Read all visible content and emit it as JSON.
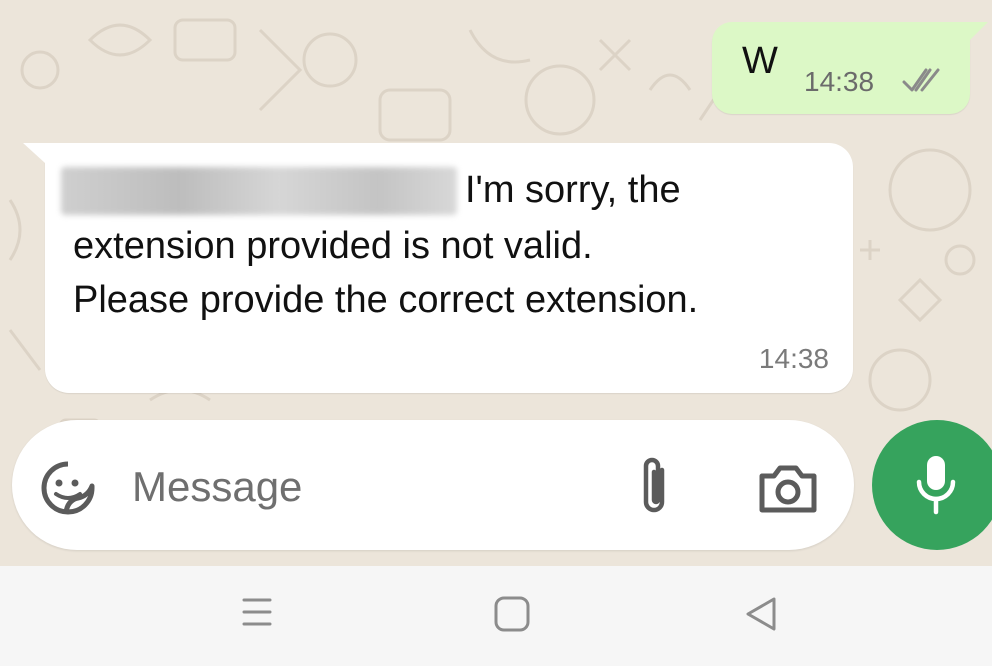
{
  "conversation": {
    "outgoing": {
      "text": "W",
      "time": "14:38",
      "status_icon": "double-check-icon"
    },
    "incoming": {
      "line1": "I'm sorry, the",
      "line2": "extension provided is not valid.",
      "line3": "Please provide the correct extension.",
      "time": "14:38"
    }
  },
  "composer": {
    "placeholder": "Message",
    "icons": [
      "sticker-icon",
      "paperclip-icon",
      "camera-icon",
      "mic-icon"
    ]
  },
  "navbar": {
    "icons": [
      "menu-icon",
      "home-icon",
      "back-icon"
    ]
  },
  "colors": {
    "chat_background": "#ece5da",
    "outgoing_bubble": "#dcf8c6",
    "incoming_bubble": "#ffffff",
    "mic_button": "#36a35d"
  }
}
